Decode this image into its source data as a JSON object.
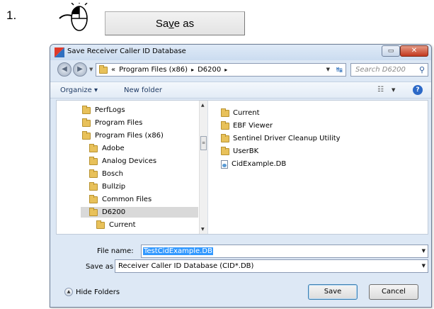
{
  "step_number": "1.",
  "save_as_button": {
    "label_before": "Sa",
    "label_accel": "v",
    "label_after": "e as"
  },
  "dialog": {
    "title": "Save Receiver Caller ID Database",
    "address": {
      "crumbs": [
        "«",
        "Program Files (x86)",
        "▸",
        "D6200",
        "▸"
      ]
    },
    "search_placeholder": "Search D6200",
    "toolbar": {
      "organize": "Organize ▾",
      "new_folder": "New folder"
    },
    "tree": [
      {
        "label": "PerfLogs",
        "indent": 0
      },
      {
        "label": "Program Files",
        "indent": 0
      },
      {
        "label": "Program Files (x86)",
        "indent": 0
      },
      {
        "label": "Adobe",
        "indent": 1
      },
      {
        "label": "Analog Devices",
        "indent": 1
      },
      {
        "label": "Bosch",
        "indent": 1
      },
      {
        "label": "Bullzip",
        "indent": 1
      },
      {
        "label": "Common Files",
        "indent": 1
      },
      {
        "label": "D6200",
        "indent": 1,
        "selected": true
      },
      {
        "label": "Current",
        "indent": 2
      }
    ],
    "files": [
      {
        "label": "Current",
        "icon": "folder"
      },
      {
        "label": "EBF Viewer",
        "icon": "folder"
      },
      {
        "label": "Sentinel Driver Cleanup Utility",
        "icon": "folder"
      },
      {
        "label": "UserBK",
        "icon": "folder"
      },
      {
        "label": "CidExample.DB",
        "icon": "database-file"
      }
    ],
    "file_name_label": "File name:",
    "file_name_value": "TestCidExample.DB",
    "save_as_type_label": "Save as type:",
    "save_as_type_value": "Receiver Caller ID Database (CID*.DB)",
    "hide_folders": "Hide Folders",
    "save_button": "Save",
    "cancel_button": "Cancel"
  }
}
